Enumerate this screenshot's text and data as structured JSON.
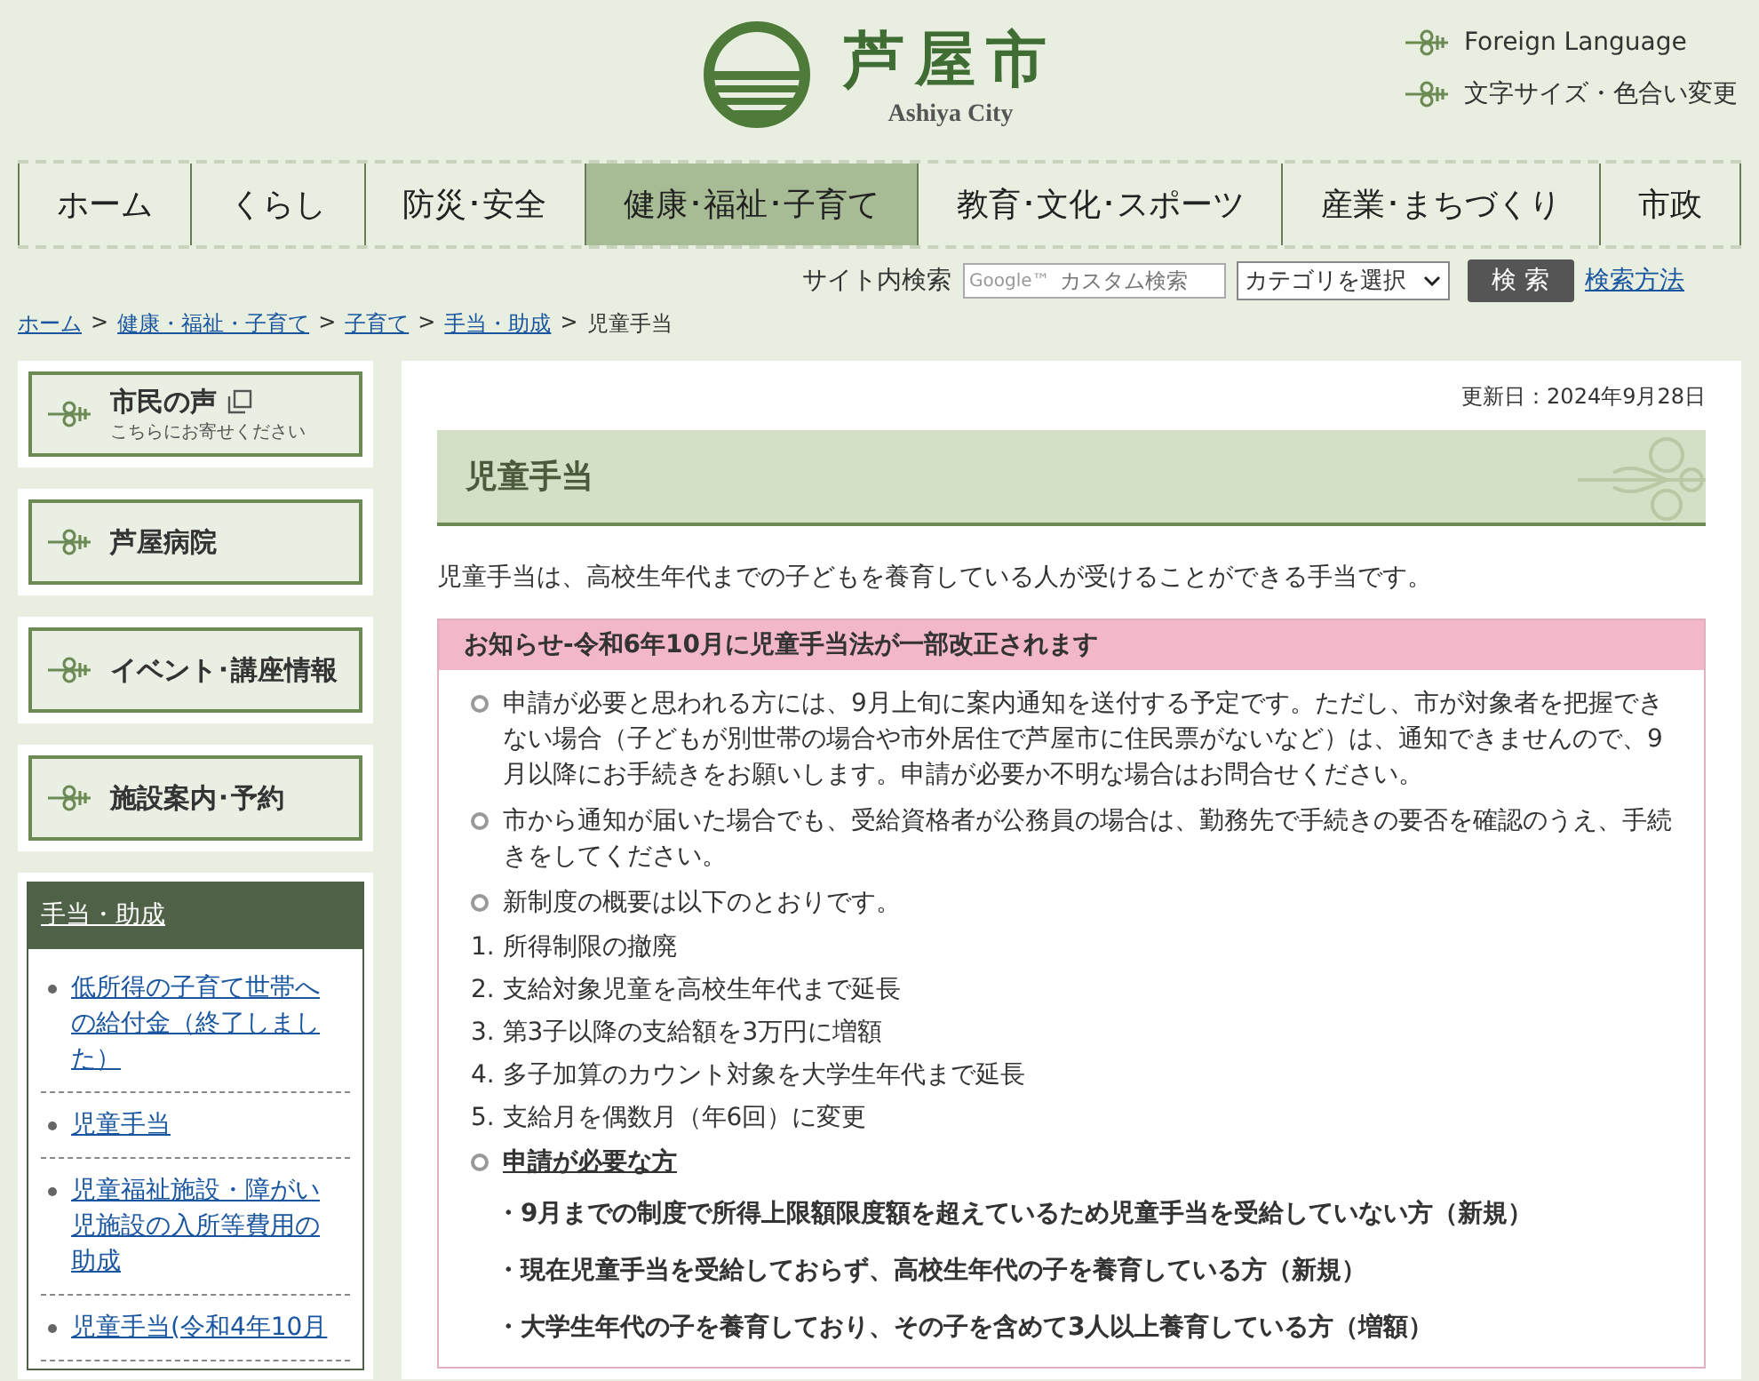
{
  "header": {
    "logo_title": "芦屋市",
    "logo_subtitle": "Ashiya City",
    "links": [
      "Foreign Language",
      "文字サイズ・色合い変更"
    ]
  },
  "nav": [
    {
      "label": "ホーム",
      "selected": false
    },
    {
      "label": "くらし",
      "selected": false
    },
    {
      "label": "防災･安全",
      "selected": false
    },
    {
      "label": "健康･福祉･子育て",
      "selected": true
    },
    {
      "label": "教育･文化･スポーツ",
      "selected": false
    },
    {
      "label": "産業･まちづくり",
      "selected": false
    },
    {
      "label": "市政",
      "selected": false
    }
  ],
  "search": {
    "label": "サイト内検索",
    "placeholder": "カスタム検索",
    "google_mark": "Google™",
    "category": "カテゴリを選択",
    "button": "検 索",
    "help_link": "検索方法"
  },
  "breadcrumb": {
    "links": [
      "ホーム",
      "健康・福祉・子育て",
      "子育て",
      "手当・助成"
    ],
    "separator": ">",
    "current": "児童手当"
  },
  "sidebar": {
    "buttons": [
      {
        "label": "市民の声",
        "subtitle": "こちらにお寄せください",
        "external": true
      },
      {
        "label": "芦屋病院",
        "external": false
      },
      {
        "label": "イベント･講座情報",
        "external": false
      },
      {
        "label": "施設案内･予約",
        "external": false
      }
    ],
    "menu": {
      "title": "手当・助成",
      "items": [
        "低所得の子育て世帯への給付金（終了しました）",
        "児童手当",
        "児童福祉施設・障がい児施設の入所等費用の助成",
        "児童手当(令和4年10月"
      ]
    }
  },
  "main": {
    "updated": "更新日：2024年9月28日",
    "title": "児童手当",
    "intro": "児童手当は、高校生年代までの子どもを養育している人が受けることができる手当です。",
    "notice": {
      "title": "お知らせ-令和6年10月に児童手当法が一部改正されます",
      "bullets": [
        "申請が必要と思われる方には、9月上旬に案内通知を送付する予定です。ただし、市が対象者を把握できない場合（子どもが別世帯の場合や市外居住で芦屋市に住民票がないなど）は、通知できませんので、9月以降にお手続きをお願いします。申請が必要か不明な場合はお問合せください。",
        "市から通知が届いた場合でも、受給資格者が公務員の場合は、勤務先で手続きの要否を確認のうえ、手続きをしてください。",
        "新制度の概要は以下のとおりです。"
      ],
      "numbered": [
        "1. 所得制限の撤廃",
        "2. 支給対象児童を高校生年代まで延長",
        "3. 第3子以降の支給額を3万円に増額",
        "4. 多子加算のカウント対象を大学生年代まで延長",
        "5. 支給月を偶数月（年6回）に変更"
      ],
      "subheading": "申請が必要な方",
      "applicants": [
        "・9月までの制度で所得上限額限度額を超えているため児童手当を受給していない方（新規）",
        "・現在児童手当を受給しておらず、高校生年代の子を養育している方（新規）",
        "・大学生年代の子を養育しており、その子を含めて3人以上養育している方（増額）"
      ]
    }
  }
}
